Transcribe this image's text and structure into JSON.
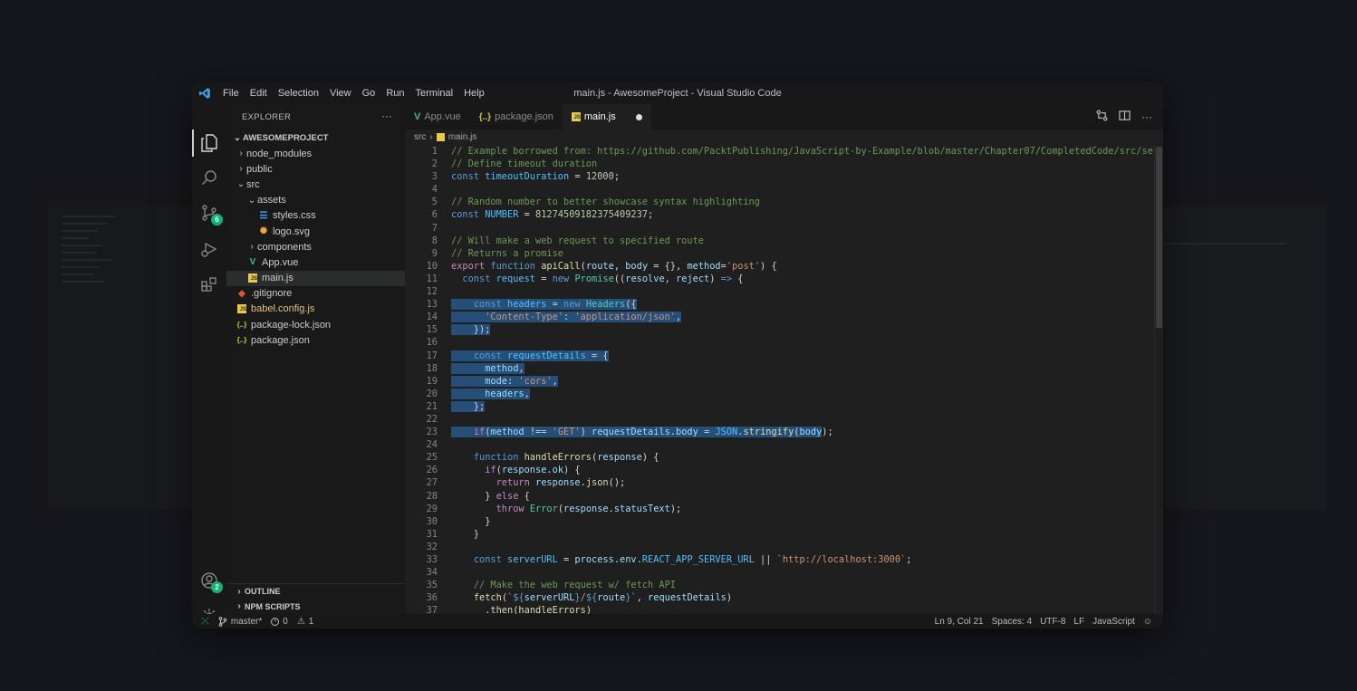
{
  "window": {
    "title": "main.js - AwesomeProject - Visual Studio Code"
  },
  "menu": [
    "File",
    "Edit",
    "Selection",
    "View",
    "Go",
    "Run",
    "Terminal",
    "Help"
  ],
  "activity": {
    "scm_badge": "6",
    "accounts_badge": "2"
  },
  "sidebar": {
    "header": "EXPLORER",
    "more": "···",
    "project": "AWESOMEPROJECT",
    "tree": [
      {
        "label": "node_modules",
        "depth": 0,
        "type": "folder",
        "open": false
      },
      {
        "label": "public",
        "depth": 0,
        "type": "folder",
        "open": false
      },
      {
        "label": "src",
        "depth": 0,
        "type": "folder",
        "open": true
      },
      {
        "label": "assets",
        "depth": 1,
        "type": "folder",
        "open": true
      },
      {
        "label": "styles.css",
        "depth": 2,
        "type": "css"
      },
      {
        "label": "logo.svg",
        "depth": 2,
        "type": "svg"
      },
      {
        "label": "components",
        "depth": 1,
        "type": "folder",
        "open": false
      },
      {
        "label": "App.vue",
        "depth": 1,
        "type": "vue"
      },
      {
        "label": "main.js",
        "depth": 1,
        "type": "js",
        "active": true
      },
      {
        "label": ".gitignore",
        "depth": 0,
        "type": "git"
      },
      {
        "label": "babel.config.js",
        "depth": 0,
        "type": "babel"
      },
      {
        "label": "package-lock.json",
        "depth": 0,
        "type": "json"
      },
      {
        "label": "package.json",
        "depth": 0,
        "type": "json"
      }
    ],
    "outline": "OUTLINE",
    "npm_scripts": "NPM SCRIPTS"
  },
  "tabs": [
    {
      "label": "App.vue",
      "icon": "vue-icon",
      "active": false
    },
    {
      "label": "package.json",
      "icon": "json-icon",
      "active": false
    },
    {
      "label": "main.js",
      "icon": "js-icon",
      "active": true,
      "modified": true
    }
  ],
  "breadcrumb": {
    "folder": "src",
    "file": "main.js"
  },
  "code_lines": [
    [
      [
        "c-com",
        "// Example borrowed from: https://github.com/PacktPublishing/JavaScript-by-Example/blob/master/Chapter07/CompletedCode/src/se"
      ]
    ],
    [
      [
        "c-com",
        "// Define timeout duration"
      ]
    ],
    [
      [
        "c-kw",
        "const "
      ],
      [
        "c-con",
        "timeoutDuration"
      ],
      [
        "c-def",
        " = "
      ],
      [
        "c-num",
        "12000"
      ],
      [
        "c-def",
        ";"
      ]
    ],
    [],
    [
      [
        "c-com",
        "// Random number to better showcase syntax highlighting"
      ]
    ],
    [
      [
        "c-kw",
        "const "
      ],
      [
        "c-con",
        "NUMBER"
      ],
      [
        "c-def",
        " = "
      ],
      [
        "c-num",
        "81274509182375409237"
      ],
      [
        "c-def",
        ";"
      ]
    ],
    [],
    [
      [
        "c-com",
        "// Will make a web request to specified route"
      ]
    ],
    [
      [
        "c-com",
        "// Returns a promise"
      ]
    ],
    [
      [
        "c-ctl",
        "export "
      ],
      [
        "c-kw",
        "function "
      ],
      [
        "c-fn",
        "apiCall"
      ],
      [
        "c-def",
        "("
      ],
      [
        "c-var",
        "route"
      ],
      [
        "c-def",
        ", "
      ],
      [
        "c-var",
        "body"
      ],
      [
        "c-def",
        " = {}, "
      ],
      [
        "c-var",
        "method"
      ],
      [
        "c-def",
        "="
      ],
      [
        "c-str",
        "'post'"
      ],
      [
        "c-def",
        ") {"
      ]
    ],
    [
      [
        "c-def",
        "  "
      ],
      [
        "c-kw",
        "const "
      ],
      [
        "c-con",
        "request"
      ],
      [
        "c-def",
        " = "
      ],
      [
        "c-kw",
        "new "
      ],
      [
        "c-cls",
        "Promise"
      ],
      [
        "c-def",
        "(("
      ],
      [
        "c-var",
        "resolve"
      ],
      [
        "c-def",
        ", "
      ],
      [
        "c-var",
        "reject"
      ],
      [
        "c-def",
        ") "
      ],
      [
        "c-kw",
        "=>"
      ],
      [
        "c-def",
        " {"
      ]
    ],
    [],
    [
      [
        "sel c-def",
        "    "
      ],
      [
        "sel c-kw",
        "const "
      ],
      [
        "sel c-con",
        "headers"
      ],
      [
        "sel c-def",
        " = "
      ],
      [
        "sel c-kw",
        "new "
      ],
      [
        "sel c-cls",
        "Headers"
      ],
      [
        "sel c-def",
        "({"
      ]
    ],
    [
      [
        "sel c-def",
        "      "
      ],
      [
        "sel c-str",
        "'Content-Type'"
      ],
      [
        "sel c-def",
        ": "
      ],
      [
        "sel c-str",
        "'application/json'"
      ],
      [
        "sel c-def",
        ","
      ]
    ],
    [
      [
        "sel c-def",
        "    });"
      ]
    ],
    [],
    [
      [
        "sel c-def",
        "    "
      ],
      [
        "sel c-kw",
        "const "
      ],
      [
        "sel c-con",
        "requestDetails"
      ],
      [
        "sel c-def",
        " = {"
      ]
    ],
    [
      [
        "sel c-def",
        "      "
      ],
      [
        "sel c-var",
        "method"
      ],
      [
        "sel c-def",
        ","
      ]
    ],
    [
      [
        "sel c-def",
        "      "
      ],
      [
        "sel c-var",
        "mode"
      ],
      [
        "sel c-def",
        ": "
      ],
      [
        "sel c-str",
        "'cors'"
      ],
      [
        "sel c-def",
        ","
      ]
    ],
    [
      [
        "sel c-def",
        "      "
      ],
      [
        "sel c-var",
        "headers"
      ],
      [
        "sel c-def",
        ","
      ]
    ],
    [
      [
        "sel c-def",
        "    };"
      ]
    ],
    [],
    [
      [
        "sel c-def",
        "    "
      ],
      [
        "sel c-ctl",
        "if"
      ],
      [
        "sel c-def",
        "("
      ],
      [
        "sel c-var",
        "method"
      ],
      [
        "sel c-def",
        " !== "
      ],
      [
        "sel c-str",
        "'GET'"
      ],
      [
        "sel c-def",
        ") "
      ],
      [
        "sel c-var",
        "requestDetails"
      ],
      [
        "sel c-def",
        "."
      ],
      [
        "sel c-var",
        "body"
      ],
      [
        "sel c-def",
        " = "
      ],
      [
        "sel c-con",
        "JSON"
      ],
      [
        "sel c-def",
        "."
      ],
      [
        "sel c-fn",
        "stringify"
      ],
      [
        "sel c-def",
        "("
      ],
      [
        "sel c-var",
        "body"
      ],
      [
        "c-def",
        ");"
      ]
    ],
    [],
    [
      [
        "c-def",
        "    "
      ],
      [
        "c-kw",
        "function "
      ],
      [
        "c-fn",
        "handleErrors"
      ],
      [
        "c-def",
        "("
      ],
      [
        "c-var",
        "response"
      ],
      [
        "c-def",
        ") {"
      ]
    ],
    [
      [
        "c-def",
        "      "
      ],
      [
        "c-ctl",
        "if"
      ],
      [
        "c-def",
        "("
      ],
      [
        "c-var",
        "response"
      ],
      [
        "c-def",
        "."
      ],
      [
        "c-var",
        "ok"
      ],
      [
        "c-def",
        ") {"
      ]
    ],
    [
      [
        "c-def",
        "        "
      ],
      [
        "c-ctl",
        "return "
      ],
      [
        "c-var",
        "response"
      ],
      [
        "c-def",
        "."
      ],
      [
        "c-fn",
        "json"
      ],
      [
        "c-def",
        "();"
      ]
    ],
    [
      [
        "c-def",
        "      } "
      ],
      [
        "c-ctl",
        "else"
      ],
      [
        "c-def",
        " {"
      ]
    ],
    [
      [
        "c-def",
        "        "
      ],
      [
        "c-ctl",
        "throw "
      ],
      [
        "c-cls",
        "Error"
      ],
      [
        "c-def",
        "("
      ],
      [
        "c-var",
        "response"
      ],
      [
        "c-def",
        "."
      ],
      [
        "c-var",
        "statusText"
      ],
      [
        "c-def",
        ");"
      ]
    ],
    [
      [
        "c-def",
        "      }"
      ]
    ],
    [
      [
        "c-def",
        "    }"
      ]
    ],
    [],
    [
      [
        "c-def",
        "    "
      ],
      [
        "c-kw",
        "const "
      ],
      [
        "c-con",
        "serverURL"
      ],
      [
        "c-def",
        " = "
      ],
      [
        "c-var",
        "process"
      ],
      [
        "c-def",
        "."
      ],
      [
        "c-var",
        "env"
      ],
      [
        "c-def",
        "."
      ],
      [
        "c-con",
        "REACT_APP_SERVER_URL"
      ],
      [
        "c-def",
        " || "
      ],
      [
        "c-str",
        "`http://localhost:3000`"
      ],
      [
        "c-def",
        ";"
      ]
    ],
    [],
    [
      [
        "c-def",
        "    "
      ],
      [
        "c-com",
        "// Make the web request w/ fetch API"
      ]
    ],
    [
      [
        "c-def",
        "    "
      ],
      [
        "c-fn",
        "fetch"
      ],
      [
        "c-def",
        "("
      ],
      [
        "c-str",
        "`"
      ],
      [
        "c-kw",
        "${"
      ],
      [
        "c-var",
        "serverURL"
      ],
      [
        "c-kw",
        "}"
      ],
      [
        "c-str",
        "/"
      ],
      [
        "c-kw",
        "${"
      ],
      [
        "c-var",
        "route"
      ],
      [
        "c-kw",
        "}"
      ],
      [
        "c-str",
        "`"
      ],
      [
        "c-def",
        ", "
      ],
      [
        "c-var",
        "requestDetails"
      ],
      [
        "c-def",
        ")"
      ]
    ],
    [
      [
        "c-def",
        "      ."
      ],
      [
        "c-fn",
        "then"
      ],
      [
        "c-def",
        "("
      ],
      [
        "c-fn",
        "handleErrors"
      ],
      [
        "c-def",
        ")"
      ]
    ]
  ],
  "status": {
    "branch": "master*",
    "errors": "0",
    "warnings": "1",
    "position": "Ln 9, Col 21",
    "spaces": "Spaces: 4",
    "encoding": "UTF-8",
    "eol": "LF",
    "language": "JavaScript"
  },
  "colors": {
    "accent_badge": "#12b376",
    "editor_bg": "#1f1f1f",
    "selection": "#264f78"
  }
}
